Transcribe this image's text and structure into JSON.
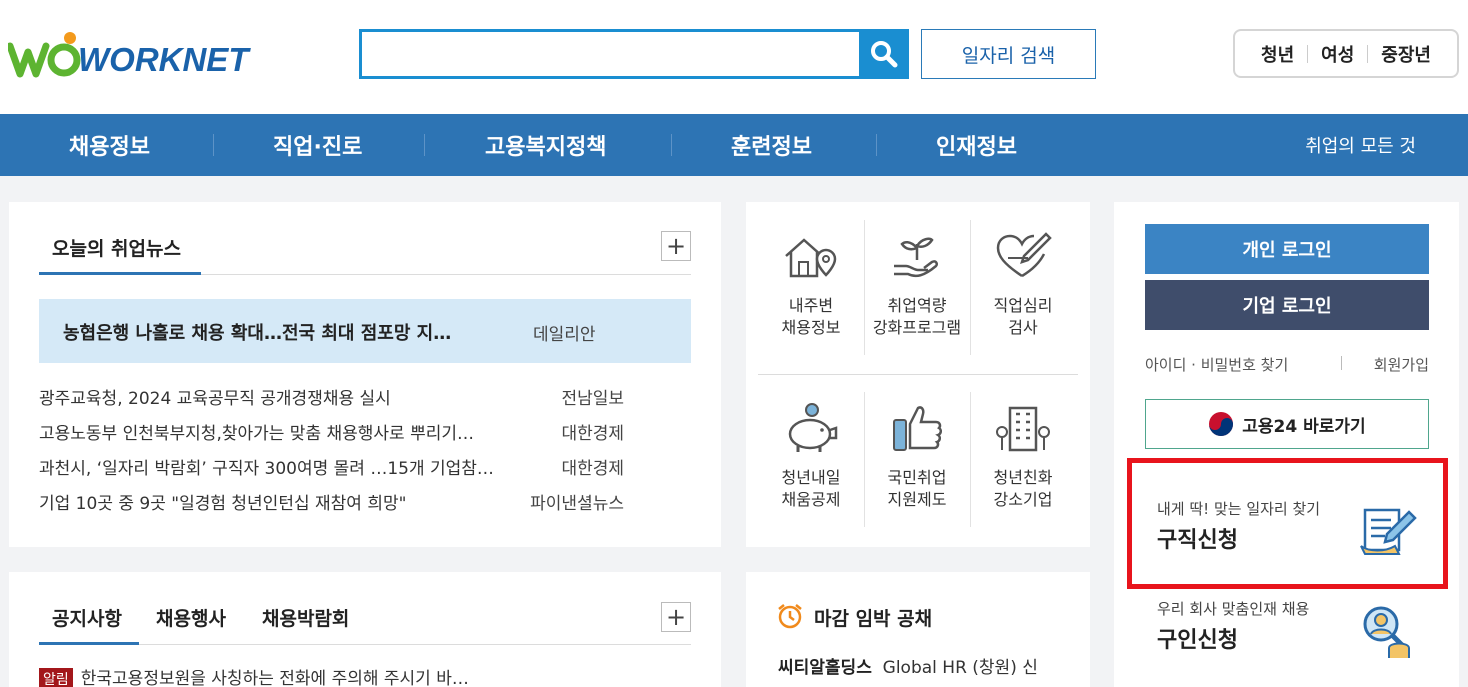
{
  "brand": {
    "logo_text": "WORKNET"
  },
  "header": {
    "search_placeholder": "",
    "job_search_label": "일자리 검색",
    "targets": [
      "청년",
      "여성",
      "중장년"
    ]
  },
  "nav": {
    "items": [
      "채용정보",
      "직업·진로",
      "고용복지정책",
      "훈련정보",
      "인재정보"
    ],
    "all_label": "취업의 모든 것"
  },
  "news": {
    "title": "오늘의 취업뉴스",
    "more": "+",
    "headline": {
      "title": "농협은행 나홀로 채용 확대…전국 최대 점포망 지…",
      "source": "데일리안"
    },
    "items": [
      {
        "title": "광주교육청, 2024 교육공무직 공개경쟁채용 실시",
        "source": "전남일보"
      },
      {
        "title": "고용노동부 인천북부지청,찾아가는 맞춤 채용행사로 뿌리기…",
        "source": "대한경제"
      },
      {
        "title": "과천시, ‘일자리 박람회’ 구직자 300여명 몰려 …15개 기업참…",
        "source": "대한경제"
      },
      {
        "title": "기업 10곳 중 9곳 \"일경험 청년인턴십 재참여 희망\"",
        "source": "파이낸셜뉴스"
      }
    ]
  },
  "services": [
    {
      "line1": "내주변",
      "line2": "채용정보",
      "icon": "house-location-icon"
    },
    {
      "line1": "취업역량",
      "line2": "강화프로그램",
      "icon": "sprout-hand-icon"
    },
    {
      "line1": "직업심리",
      "line2": "검사",
      "icon": "heart-pen-icon"
    },
    {
      "line1": "청년내일",
      "line2": "채움공제",
      "icon": "piggy-bank-icon"
    },
    {
      "line1": "국민취업",
      "line2": "지원제도",
      "icon": "thumbs-up-phone-icon"
    },
    {
      "line1": "청년친화",
      "line2": "강소기업",
      "icon": "building-icon"
    }
  ],
  "side": {
    "personal_login": "개인 로그인",
    "company_login": "기업 로그인",
    "find_id": "아이디 · 비밀번호 찾기",
    "signup": "회원가입",
    "go24": "고용24 바로가기",
    "job_apply": {
      "sub": "내게 딱! 맞는 일자리 찾기",
      "main": "구직신청"
    },
    "talent_apply": {
      "sub": "우리 회사 맞춤인재 채용",
      "main": "구인신청"
    }
  },
  "notice": {
    "tabs": [
      "공지사항",
      "채용행사",
      "채용박람회"
    ],
    "more": "+",
    "row": {
      "badge": "알림",
      "title": "한국고용정보원을 사칭하는 전화에 주의해 주시기 바…"
    }
  },
  "deadline": {
    "title": "마감 임박 공채",
    "company": "씨티알홀딩스",
    "posting": "Global HR (창원) 신"
  },
  "colors": {
    "primary": "#2d74b4",
    "accent": "#1a8ed1",
    "highlight": "#e8141c",
    "company_login_bg": "#3f4d6b"
  }
}
